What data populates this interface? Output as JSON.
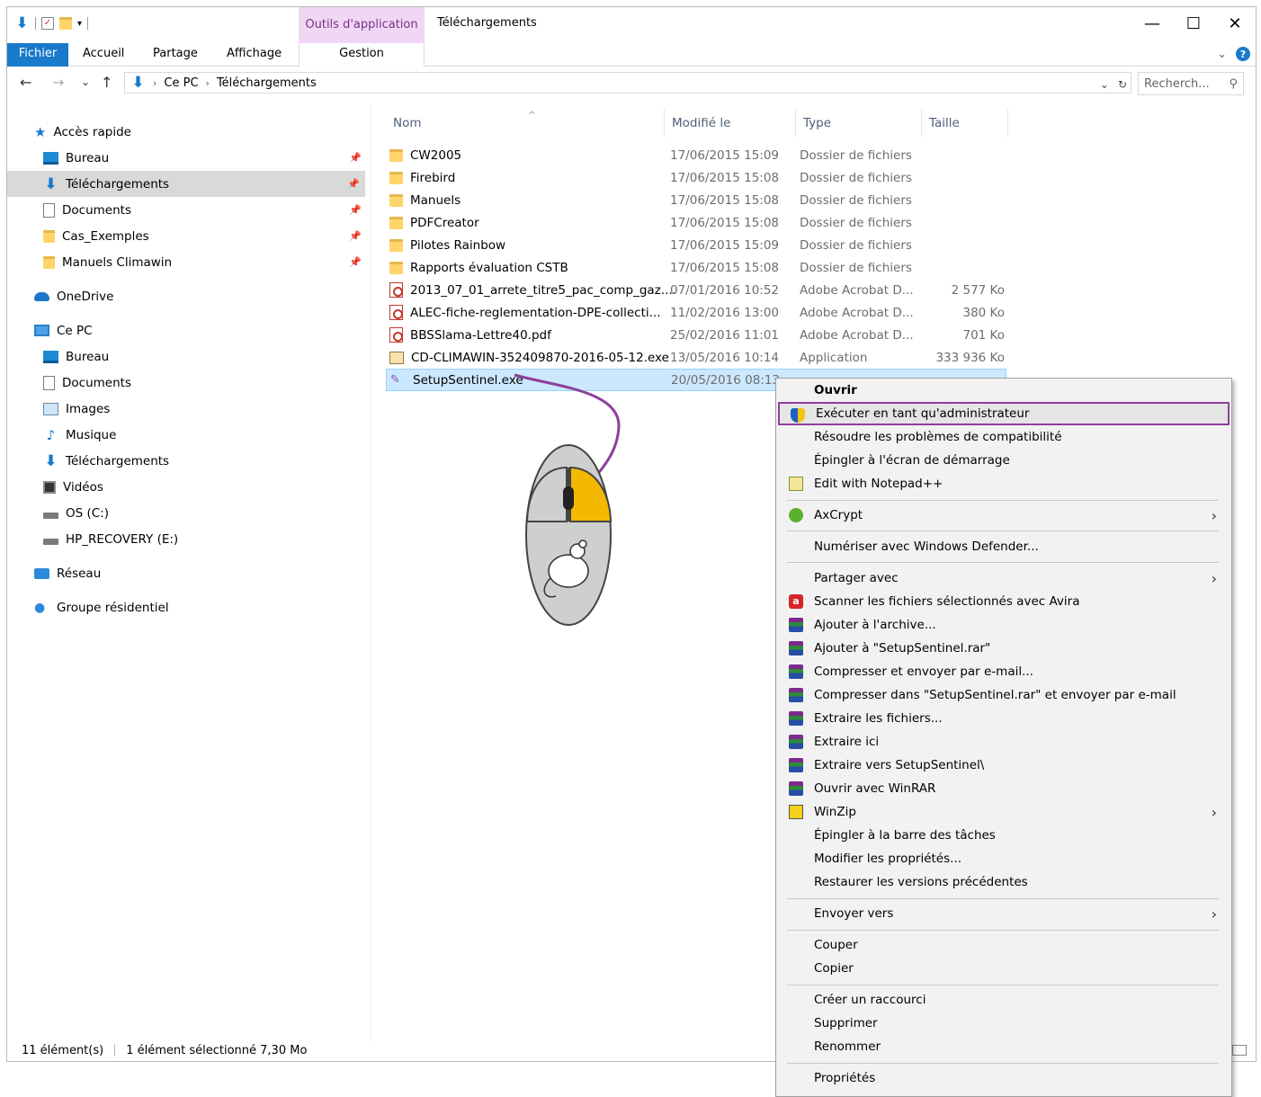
{
  "window": {
    "title": "Téléchargements",
    "context_group": "Outils d'application",
    "minimize": "—",
    "maximize": "☐",
    "close": "✕"
  },
  "ribbon": {
    "tabs": [
      "Fichier",
      "Accueil",
      "Partage",
      "Affichage",
      "Gestion"
    ],
    "help": "?",
    "collapse": "⌄"
  },
  "address": {
    "back": "←",
    "forward": "→",
    "recent": "⌄",
    "up": "↑",
    "crumbs": [
      "Ce PC",
      "Téléchargements"
    ],
    "separator": "›",
    "dropdown": "⌄",
    "refresh": "↻",
    "search_placeholder": "Recherch...",
    "search_icon": "⚲"
  },
  "sidebar": {
    "quick_access": "Accès rapide",
    "quick_items": [
      {
        "label": "Bureau",
        "icon": "desktop-icon"
      },
      {
        "label": "Téléchargements",
        "icon": "downloads-icon"
      },
      {
        "label": "Documents",
        "icon": "documents-icon"
      },
      {
        "label": "Cas_Exemples",
        "icon": "folder-icon"
      },
      {
        "label": "Manuels Climawin",
        "icon": "folder-icon"
      }
    ],
    "onedrive": "OneDrive",
    "this_pc": "Ce PC",
    "pc_items": [
      {
        "label": "Bureau",
        "icon": "desktop-icon"
      },
      {
        "label": "Documents",
        "icon": "documents-icon"
      },
      {
        "label": "Images",
        "icon": "images-icon"
      },
      {
        "label": "Musique",
        "icon": "music-icon"
      },
      {
        "label": "Téléchargements",
        "icon": "downloads-icon"
      },
      {
        "label": "Vidéos",
        "icon": "videos-icon"
      },
      {
        "label": "OS (C:)",
        "icon": "drive-icon"
      },
      {
        "label": "HP_RECOVERY (E:)",
        "icon": "drive-icon"
      }
    ],
    "network": "Réseau",
    "homegroup": "Groupe résidentiel"
  },
  "columns": {
    "name": "Nom",
    "modified": "Modifié le",
    "type": "Type",
    "size": "Taille"
  },
  "files": [
    {
      "name": "CW2005",
      "modified": "17/06/2015 15:09",
      "type": "Dossier de fichiers",
      "size": "",
      "icon": "folder-icon"
    },
    {
      "name": "Firebird",
      "modified": "17/06/2015 15:08",
      "type": "Dossier de fichiers",
      "size": "",
      "icon": "folder-icon"
    },
    {
      "name": "Manuels",
      "modified": "17/06/2015 15:08",
      "type": "Dossier de fichiers",
      "size": "",
      "icon": "folder-icon"
    },
    {
      "name": "PDFCreator",
      "modified": "17/06/2015 15:08",
      "type": "Dossier de fichiers",
      "size": "",
      "icon": "folder-icon"
    },
    {
      "name": "Pilotes Rainbow",
      "modified": "17/06/2015 15:09",
      "type": "Dossier de fichiers",
      "size": "",
      "icon": "folder-icon"
    },
    {
      "name": "Rapports évaluation CSTB",
      "modified": "17/06/2015 15:08",
      "type": "Dossier de fichiers",
      "size": "",
      "icon": "folder-icon"
    },
    {
      "name": "2013_07_01_arrete_titre5_pac_comp_gaz....",
      "modified": "07/01/2016 10:52",
      "type": "Adobe Acrobat D...",
      "size": "2 577 Ko",
      "icon": "pdf-icon"
    },
    {
      "name": "ALEC-fiche-reglementation-DPE-collecti...",
      "modified": "11/02/2016 13:00",
      "type": "Adobe Acrobat D...",
      "size": "380 Ko",
      "icon": "pdf-icon"
    },
    {
      "name": "BBSSlama-Lettre40.pdf",
      "modified": "25/02/2016 11:01",
      "type": "Adobe Acrobat D...",
      "size": "701 Ko",
      "icon": "pdf-icon"
    },
    {
      "name": "CD-CLIMAWIN-352409870-2016-05-12.exe",
      "modified": "13/05/2016 10:14",
      "type": "Application",
      "size": "333 936 Ko",
      "icon": "exe-icon"
    },
    {
      "name": "SetupSentinel.exe",
      "modified": "20/05/2016 08:13",
      "type": "",
      "size": "",
      "icon": "setup-icon"
    }
  ],
  "status": {
    "count": "11 élément(s)",
    "selection": "1 élément sélectionné 7,30 Mo"
  },
  "context_menu": [
    {
      "label": "Ouvrir",
      "bold": true
    },
    {
      "label": "Exécuter en tant qu'administrateur",
      "icon": "uac-shield-icon",
      "highlight": true
    },
    {
      "label": "Résoudre les problèmes de compatibilité"
    },
    {
      "label": "Épingler à l'écran de démarrage"
    },
    {
      "label": "Edit with Notepad++",
      "icon": "notepad-plus-plus-icon"
    },
    {
      "label": "AxCrypt",
      "icon": "axcrypt-icon",
      "submenu": true
    },
    {
      "label": "Numériser avec Windows Defender..."
    },
    {
      "label": "Partager avec",
      "submenu": true
    },
    {
      "label": "Scanner les fichiers sélectionnés avec Avira",
      "icon": "avira-icon"
    },
    {
      "label": "Ajouter à l'archive...",
      "icon": "winrar-icon"
    },
    {
      "label": "Ajouter à \"SetupSentinel.rar\"",
      "icon": "winrar-icon"
    },
    {
      "label": "Compresser et envoyer par e-mail...",
      "icon": "winrar-icon"
    },
    {
      "label": "Compresser dans \"SetupSentinel.rar\" et envoyer par e-mail",
      "icon": "winrar-icon"
    },
    {
      "label": "Extraire les fichiers...",
      "icon": "winrar-icon"
    },
    {
      "label": "Extraire ici",
      "icon": "winrar-icon"
    },
    {
      "label": "Extraire vers SetupSentinel\\",
      "icon": "winrar-icon"
    },
    {
      "label": "Ouvrir avec WinRAR",
      "icon": "winrar-icon"
    },
    {
      "label": "WinZip",
      "icon": "winzip-icon",
      "submenu": true
    },
    {
      "label": "Épingler à la barre des tâches"
    },
    {
      "label": "Modifier les propriétés..."
    },
    {
      "label": "Restaurer les versions précédentes"
    },
    {
      "label": "Envoyer vers",
      "submenu": true
    },
    {
      "label": "Couper"
    },
    {
      "label": "Copier"
    },
    {
      "label": "Créer un raccourci"
    },
    {
      "label": "Supprimer"
    },
    {
      "label": "Renommer"
    },
    {
      "label": "Propriétés"
    }
  ],
  "colors": {
    "accent": "#1979ca",
    "highlight_border": "#8e3f9b",
    "selection": "#cce8ff",
    "mouse_button": "#f5b800"
  }
}
